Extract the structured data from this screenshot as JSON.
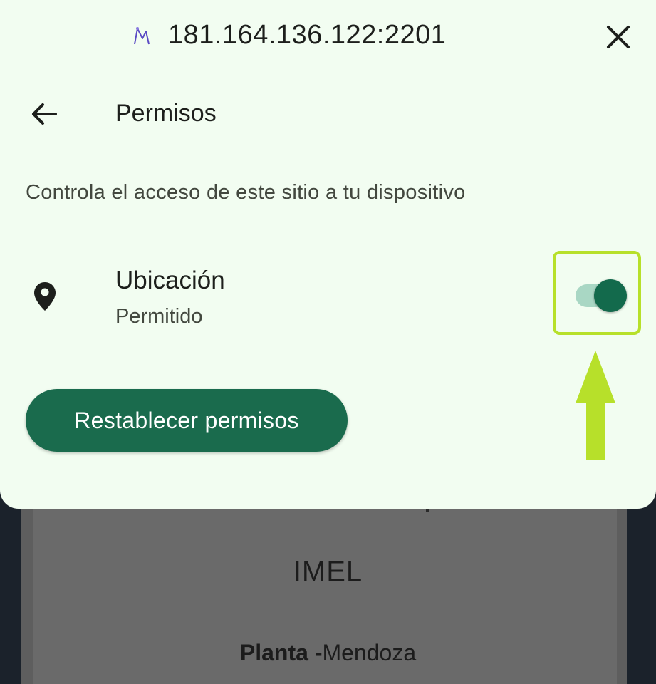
{
  "dialog": {
    "url": "181.164.136.122:2201",
    "favicon": "site-favicon-icon",
    "close_icon": "close-icon",
    "back_icon": "arrow-back-icon",
    "title": "Permisos",
    "description": "Controla el acceso de este sitio a tu dispositivo",
    "permission": {
      "icon": "location-pin-icon",
      "name": "Ubicación",
      "status": "Permitido",
      "enabled": true
    },
    "reset_button_label": "Restablecer permisos"
  },
  "background_page": {
    "title": "IMEL",
    "subtitle_bold": "Planta -",
    "subtitle_rest": "Mendoza"
  },
  "annotation": {
    "highlight_color": "#b7e02a",
    "arrow_icon": "arrow-up-icon"
  },
  "colors": {
    "sheet_bg": "#f2fdf1",
    "accent": "#1a6b4d",
    "toggle_track": "#a9d7c4",
    "toggle_thumb": "#136a4c"
  }
}
